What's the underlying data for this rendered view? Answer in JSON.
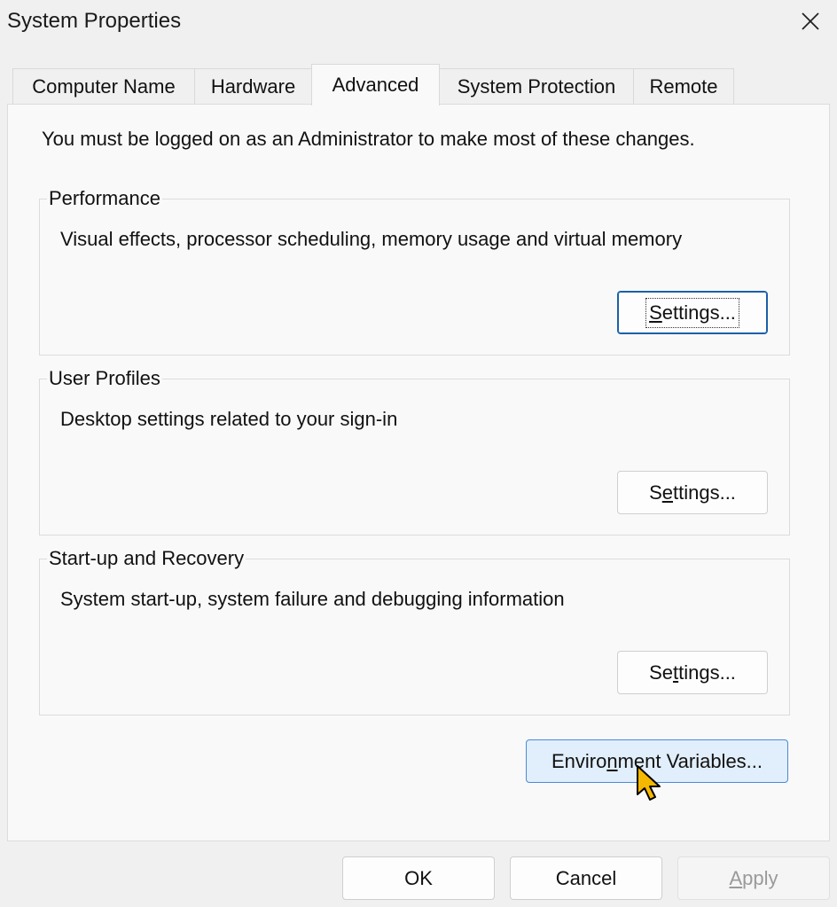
{
  "window": {
    "title": "System Properties"
  },
  "tabs": [
    {
      "label": "Computer Name"
    },
    {
      "label": "Hardware"
    },
    {
      "label": "Advanced"
    },
    {
      "label": "System Protection"
    },
    {
      "label": "Remote"
    }
  ],
  "active_tab": "Advanced",
  "main": {
    "admin_note": "You must be logged on as an Administrator to make most of these changes.",
    "groups": [
      {
        "title": "Performance",
        "description": "Visual effects, processor scheduling, memory usage and virtual memory",
        "button": {
          "pre": "",
          "u": "S",
          "post": "ettings..."
        }
      },
      {
        "title": "User Profiles",
        "description": "Desktop settings related to your sign-in",
        "button": {
          "pre": "S",
          "u": "e",
          "post": "ttings..."
        }
      },
      {
        "title": "Start-up and Recovery",
        "description": "System start-up, system failure and debugging information",
        "button": {
          "pre": "Se",
          "u": "t",
          "post": "tings..."
        }
      }
    ],
    "env_button": {
      "pre": "Enviro",
      "u": "n",
      "post": "ment Variables..."
    }
  },
  "footer": {
    "ok": "OK",
    "cancel": "Cancel",
    "apply": {
      "pre": "",
      "u": "A",
      "post": "pply"
    }
  },
  "colors": {
    "focus_border": "#1b5fa8",
    "hover_bg": "#e1eefb",
    "cursor_fill": "#f5b800"
  },
  "icons": {
    "close": "close-icon",
    "cursor": "pointer-cursor-icon"
  }
}
